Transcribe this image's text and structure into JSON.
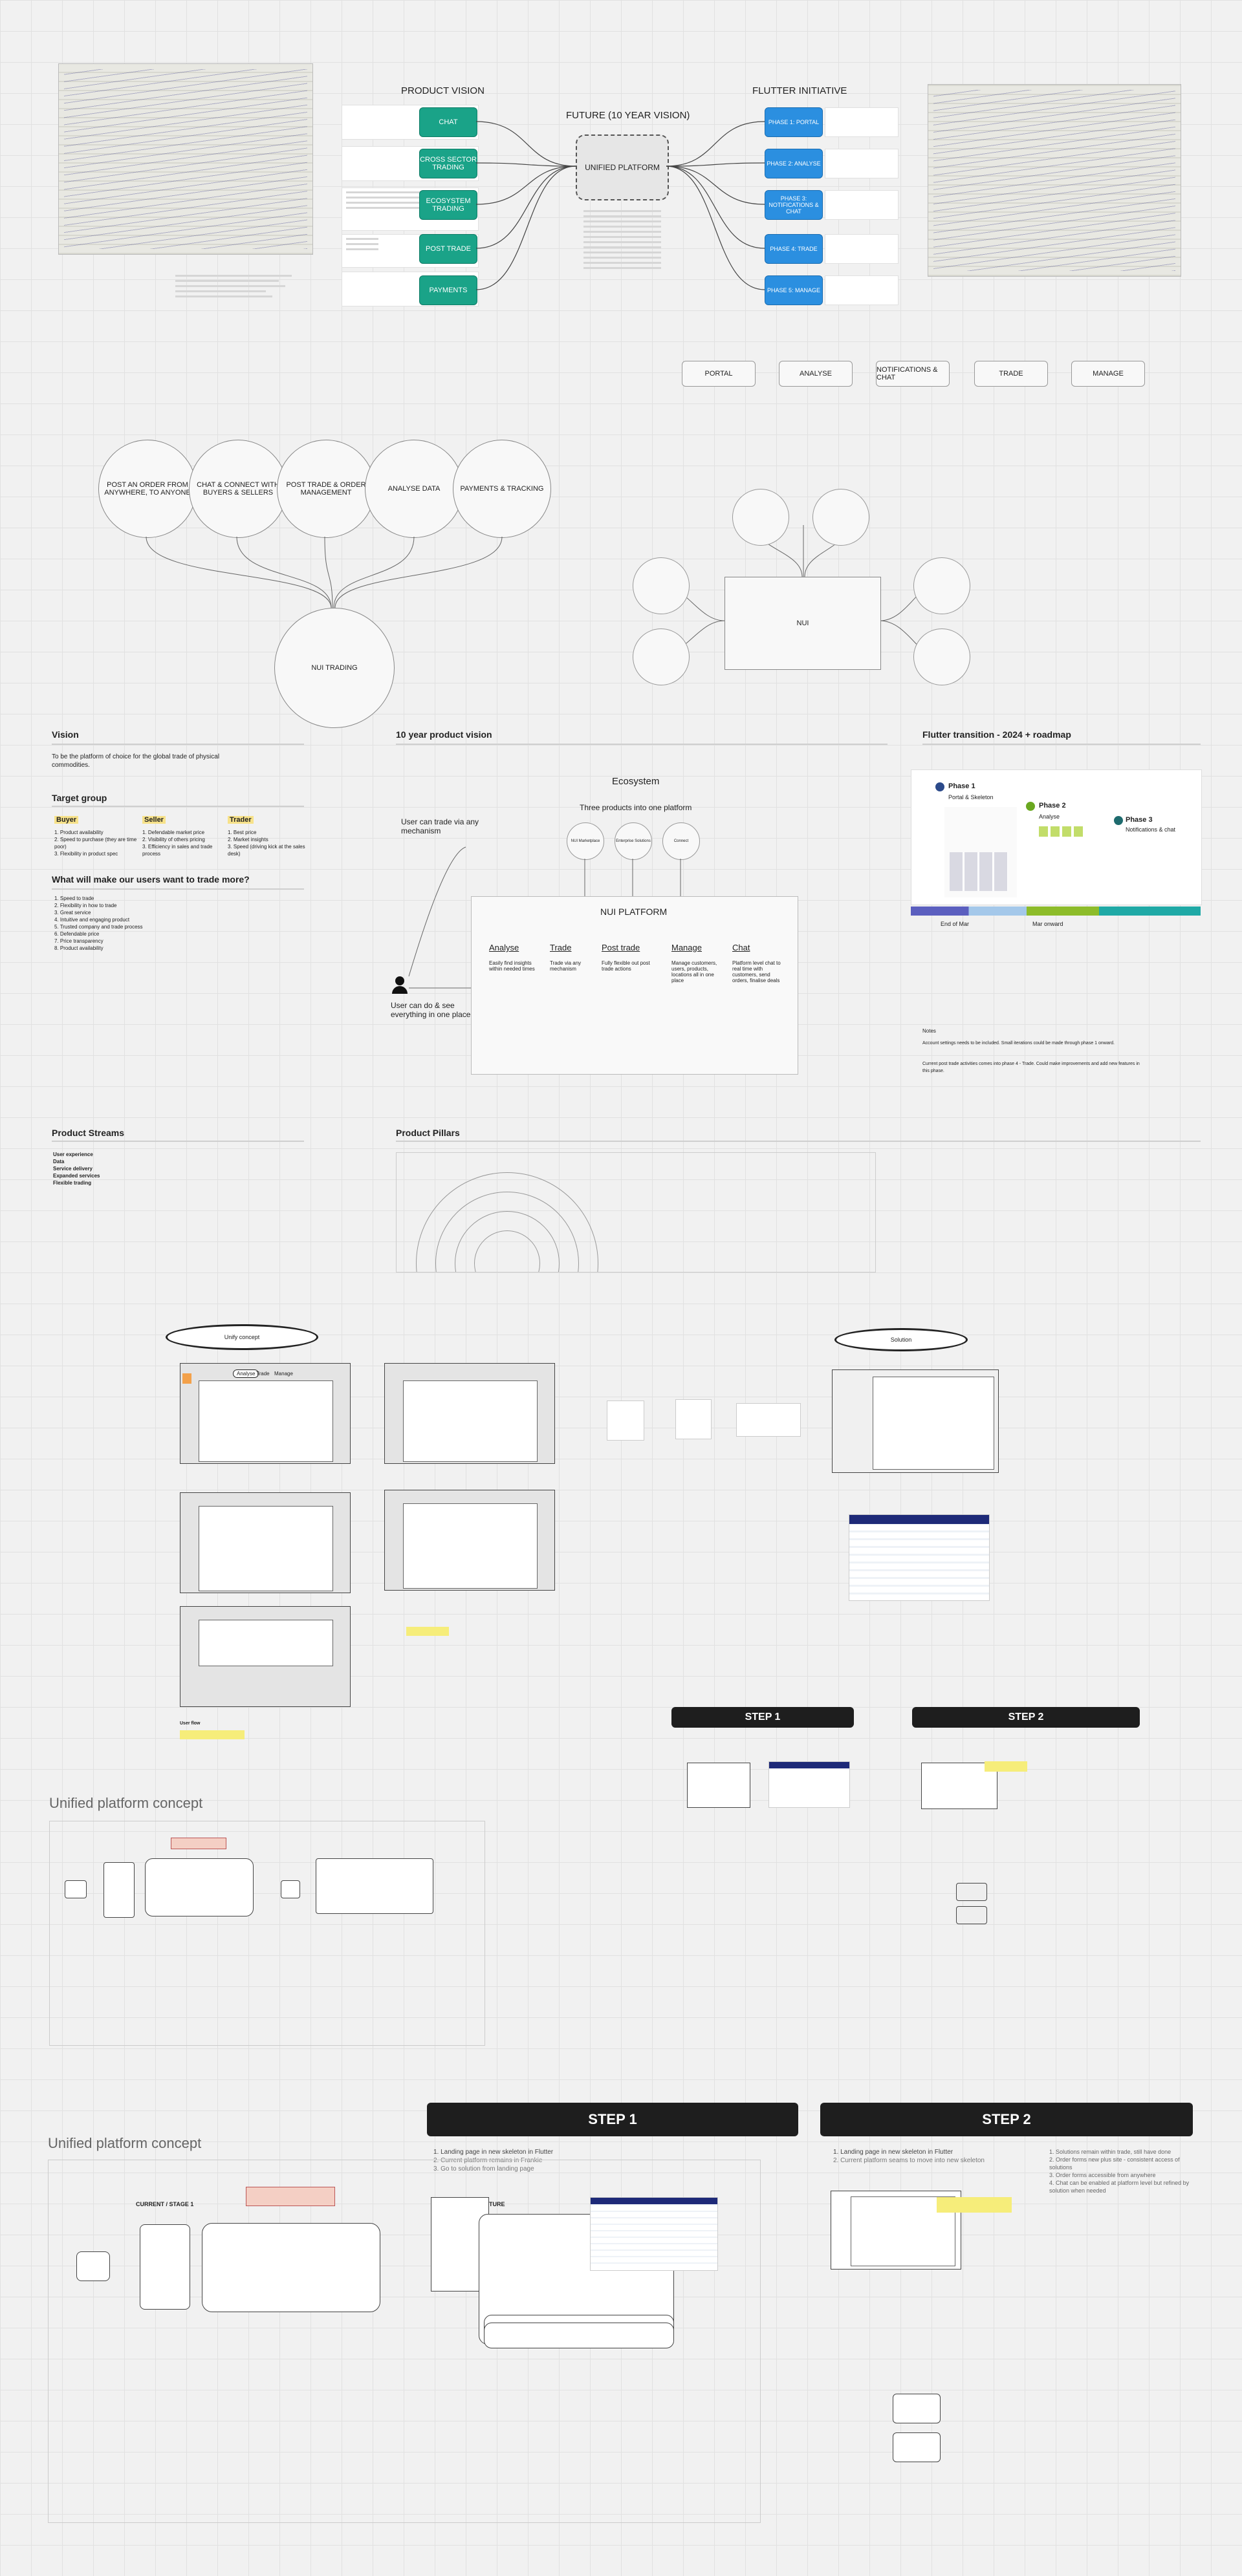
{
  "board": {
    "product_vision": {
      "title": "PRODUCT VISION",
      "pills": [
        "CHAT",
        "CROSS SECTOR TRADING",
        "ECOSYSTEM TRADING",
        "POST TRADE",
        "PAYMENTS"
      ]
    },
    "future": {
      "title": "FUTURE (10 YEAR VISION)",
      "center": "UNIFIED PLATFORM"
    },
    "flutter_initiative": {
      "title": "FLUTTER INITIATIVE",
      "pills": [
        "PHASE 1: PORTAL",
        "PHASE 2: ANALYSE",
        "PHASE 3: NOTIFICATIONS & CHAT",
        "PHASE 4: TRADE",
        "PHASE 5: MANAGE"
      ]
    },
    "flow": [
      "PORTAL",
      "ANALYSE",
      "NOTIFICATIONS & CHAT",
      "TRADE",
      "MANAGE"
    ],
    "big_circles": [
      "POST AN ORDER FROM ANYWHERE, TO ANYONE",
      "CHAT & CONNECT WITH BUYERS & SELLERS",
      "POST TRADE & ORDER MANAGEMENT",
      "ANALYSE DATA",
      "PAYMENTS & TRACKING"
    ],
    "hub_circle": "NUI TRADING",
    "nui_box": "NUI",
    "vision": {
      "title": "Vision",
      "text": "To be the platform of choice for the global trade of physical commodities."
    },
    "target_group": {
      "title": "Target group",
      "buyer": {
        "label": "Buyer",
        "items": [
          "1. Product availability",
          "2. Speed to purchase (they are time poor)",
          "3. Flexibility in product spec"
        ]
      },
      "seller": {
        "label": "Seller",
        "items": [
          "1. Defendable market price",
          "2. Visibility of others pricing",
          "3. Efficiency in sales and trade process"
        ]
      },
      "trader": {
        "label": "Trader",
        "items": [
          "1. Best price",
          "2. Market insights",
          "3. Speed (driving kick at the sales desk)"
        ]
      }
    },
    "what_more": {
      "title": "What will make our users want to trade more?",
      "items": [
        "1. Speed to trade",
        "2. Flexibility in how to trade",
        "3. Great service",
        "4. Intuitive and engaging product",
        "5. Trusted company and trade process",
        "6. Defendable price",
        "7. Price transparency",
        "8. Product availability"
      ]
    },
    "ten_year": {
      "title": "10 year product vision",
      "ecosystem": "Ecosystem",
      "three_products": "Three products into one platform",
      "small_circles": [
        "NUI Marketplace",
        "Enterprise Solutions",
        "Connect"
      ],
      "user_trade": "User can trade via any mechanism",
      "user_do": "User can do & see everything in one place",
      "platform_title": "NUI PLATFORM",
      "columns": [
        {
          "head": "Analyse",
          "body": "Easily find insights within needed times"
        },
        {
          "head": "Trade",
          "body": "Trade via any mechanism"
        },
        {
          "head": "Post trade",
          "body": "Fully flexible out post trade actions"
        },
        {
          "head": "Manage",
          "body": "Manage customers, users, products, locations all in one place"
        },
        {
          "head": "Chat",
          "body": "Platform level chat to real time with customers, send orders, finalise deals"
        }
      ]
    },
    "flutter_roadmap": {
      "title": "Flutter transition - 2024 + roadmap",
      "phases": [
        {
          "name": "Phase 1",
          "sub": "Portal & Skeleton"
        },
        {
          "name": "Phase 2",
          "sub": "Analyse"
        },
        {
          "name": "Phase 3",
          "sub": "Notifications & chat"
        }
      ],
      "timeline": [
        "End of Mar",
        "Mar onward"
      ],
      "notes_title": "Notes",
      "notes": [
        "Account settings needs to be included. Small iterations could be made through phase 1 onward.",
        "Current post trade activities comes into phase 4 - Trade. Could make improvements and add new features in this phase."
      ]
    },
    "streams": {
      "title": "Product Streams",
      "items": [
        "User experience",
        "Data",
        "Service delivery",
        "Expanded services",
        "Flexible trading"
      ]
    },
    "pillars": {
      "title": "Product Pillars"
    },
    "wireframes": {
      "ellipse_left": "Unify concept",
      "ellipse_right": "Solution",
      "nav_tabs": [
        "Analyse",
        "Trade",
        "Manage"
      ],
      "tab_analyse": "Analyse",
      "tab_trade": "Trade",
      "tab_manage": "Manage",
      "user_flow": "User flow"
    },
    "steps_mid": {
      "step1": "STEP 1",
      "step2": "STEP 2"
    },
    "concept_mid": {
      "title": "Unified platform concept"
    },
    "steps_bottom": {
      "step1": "STEP 1",
      "step2": "STEP 2",
      "step1_notes": [
        "1. Landing page in new skeleton in Flutter",
        "2. Current platform remains in Frankie",
        "3. Go to solution from landing page"
      ],
      "step2_notes": [
        "1. Landing page in new skeleton in Flutter",
        "2. Current platform seams to move into new skeleton"
      ],
      "step2_right": [
        "1. Solutions remain within trade, still have done",
        "2. Order forms new plus site - consistent access of solutions",
        "3. Order forms accessible from anywhere",
        "4. Chat can be enabled at platform level but refined by solution when needed"
      ],
      "future": "FUTURE"
    },
    "concept_bottom": {
      "title": "Unified platform concept",
      "current": "CURRENT / STAGE 1"
    }
  },
  "colors": {
    "green": "#1aa388",
    "blue": "#2b8fe0",
    "yellow": "#f6ed7a",
    "dark": "#1e1e1e",
    "tag": "#f7e28a"
  }
}
